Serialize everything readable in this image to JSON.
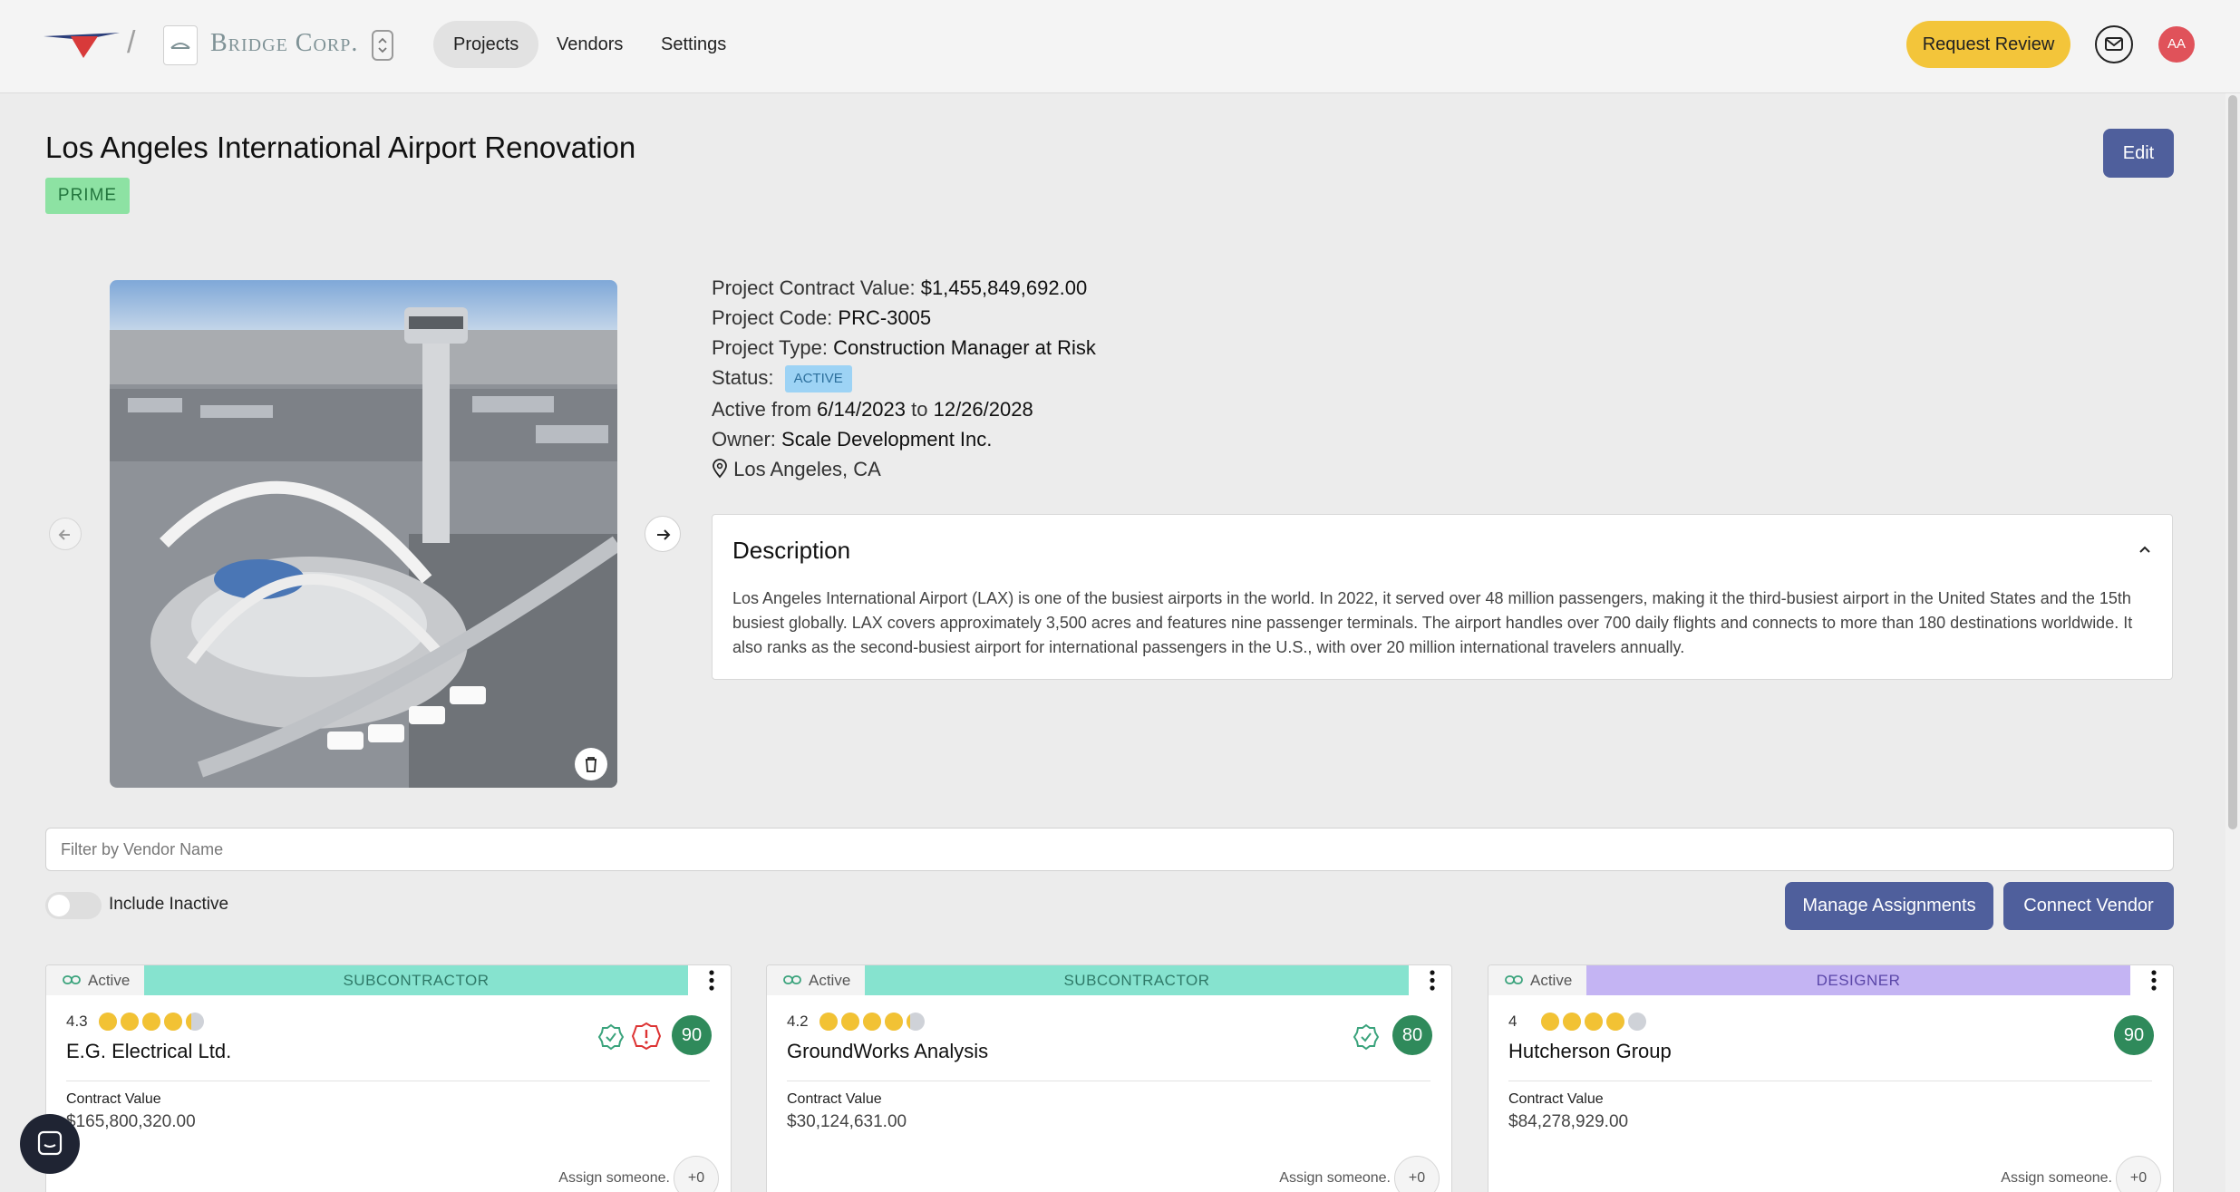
{
  "topbar": {
    "brand": "Bridge Corp.",
    "nav": [
      "Projects",
      "Vendors",
      "Settings"
    ],
    "request_review_label": "Request Review",
    "avatar_initials": "AA"
  },
  "project": {
    "title": "Los Angeles International Airport Renovation",
    "tier_badge": "PRIME",
    "edit_label": "Edit",
    "contract_value_label": "Project Contract Value: ",
    "contract_value": "$1,455,849,692.00",
    "code_label": "Project Code: ",
    "code": "PRC-3005",
    "type_label": "Project Type: ",
    "type": "Construction Manager at Risk",
    "status_label": "Status: ",
    "status": "ACTIVE",
    "active_from_label": "Active from ",
    "start_date": "6/14/2023",
    "to_label": " to ",
    "end_date": "12/26/2028",
    "owner_label": "Owner: ",
    "owner": "Scale Development Inc.",
    "location": "Los Angeles, CA"
  },
  "description": {
    "title": "Description",
    "body": "Los Angeles International Airport (LAX) is one of the busiest airports in the world. In 2022, it served over 48 million passengers, making it the third-busiest airport in the United States and the 15th busiest globally. LAX covers approximately 3,500 acres and features nine passenger terminals. The airport handles over 700 daily flights and connects to more than 180 destinations worldwide. It also ranks as the second-busiest airport for international passengers in the U.S., with over 20 million international travelers annually."
  },
  "filters": {
    "vendor_placeholder": "Filter by Vendor Name",
    "include_inactive_label": "Include Inactive",
    "include_inactive": false,
    "manage_label": "Manage Assignments",
    "connect_label": "Connect Vendor"
  },
  "vendors": [
    {
      "status": "Active",
      "type": "SUBCONTRACTOR",
      "type_color": "#86e3cf",
      "type_text_color": "#2f7a68",
      "rating": "4.3",
      "rating_value": 4.3,
      "name": "E.G. Electrical Ltd.",
      "score": "90",
      "verified": true,
      "warning": true,
      "contract_label": "Contract Value",
      "contract_value": "$165,800,320.00",
      "assign_label": "Assign someone.",
      "assign_count": "+0"
    },
    {
      "status": "Active",
      "type": "SUBCONTRACTOR",
      "type_color": "#86e3cf",
      "type_text_color": "#2f7a68",
      "rating": "4.2",
      "rating_value": 4.2,
      "name": "GroundWorks Analysis",
      "score": "80",
      "verified": true,
      "warning": false,
      "contract_label": "Contract Value",
      "contract_value": "$30,124,631.00",
      "assign_label": "Assign someone.",
      "assign_count": "+0"
    },
    {
      "status": "Active",
      "type": "DESIGNER",
      "type_color": "#c4b4f3",
      "type_text_color": "#5a46a8",
      "rating": "4",
      "rating_value": 4,
      "name": "Hutcherson Group",
      "score": "90",
      "verified": false,
      "warning": false,
      "contract_label": "Contract Value",
      "contract_value": "$84,278,929.00",
      "assign_label": "Assign someone.",
      "assign_count": "+0"
    }
  ],
  "colors": {
    "accent": "#4f5f9c",
    "cta": "#f3c53a",
    "score": "#2f8a5b",
    "star": "#f2c234"
  },
  "icons": [
    "logo-icon",
    "chevron-updown-icon",
    "mail-icon",
    "arrow-left-icon",
    "arrow-right-icon",
    "trash-icon",
    "map-pin-icon",
    "chevron-up-icon",
    "link-icon",
    "kebab-menu-icon",
    "verified-check-icon",
    "warning-icon",
    "chat-icon"
  ]
}
